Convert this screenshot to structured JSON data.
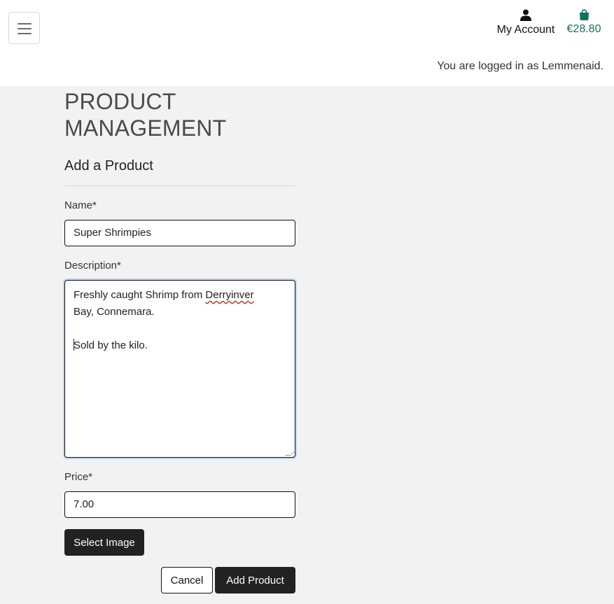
{
  "header": {
    "account_label": "My Account",
    "bag_total": "€28.80",
    "logged_in_text": "You are logged in as Lemmenaid.",
    "accent_color": "#0f7360"
  },
  "page": {
    "title": "PRODUCT MANAGEMENT",
    "section_title": "Add a Product"
  },
  "form": {
    "name_label": "Name*",
    "name_value": "Super Shrimpies",
    "description_label": "Description*",
    "description_lines": {
      "line1_prefix": "Freshly caught Shrimp from ",
      "line1_misspelled": "Derryinver",
      "line2": "Bay, Connemara.",
      "line3": "",
      "line4": "Sold by the kilo."
    },
    "price_label": "Price*",
    "price_value": "7.00",
    "select_image_label": "Select Image",
    "cancel_label": "Cancel",
    "submit_label": "Add Product"
  },
  "icons": {
    "menu": "hamburger-menu-icon",
    "account": "user-icon",
    "bag": "shopping-bag-icon"
  }
}
